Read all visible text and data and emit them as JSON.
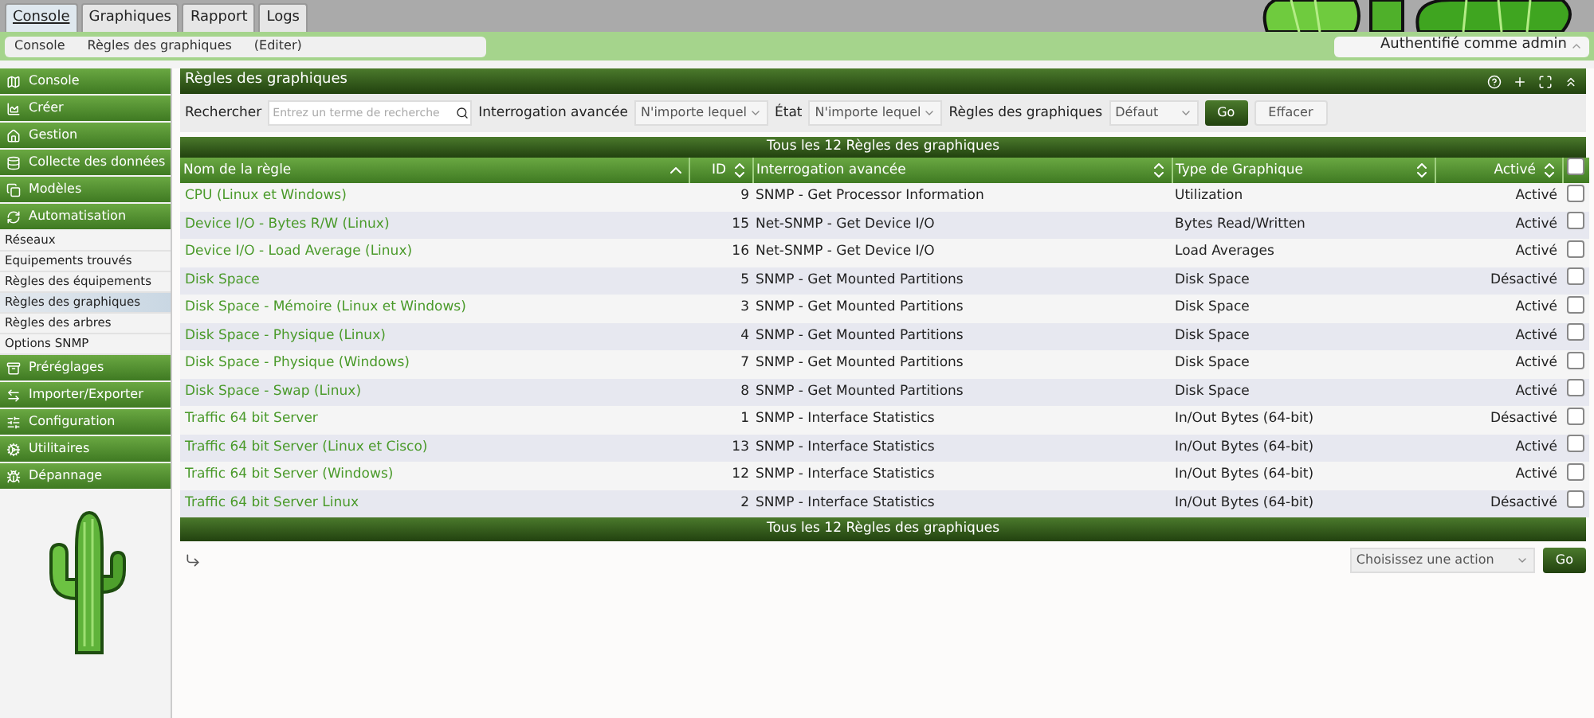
{
  "top_tabs": [
    {
      "label": "Console",
      "selected": true
    },
    {
      "label": "Graphiques",
      "selected": false
    },
    {
      "label": "Rapport",
      "selected": false
    },
    {
      "label": "Logs",
      "selected": false
    }
  ],
  "breadcrumb": [
    "Console",
    "Règles des graphiques",
    "(Editer)"
  ],
  "user": {
    "label": "Authentifié comme admin"
  },
  "sidebar": [
    {
      "kind": "section",
      "label": "Console"
    },
    {
      "kind": "section",
      "label": "Créer"
    },
    {
      "kind": "section",
      "label": "Gestion"
    },
    {
      "kind": "section",
      "label": "Collecte des données"
    },
    {
      "kind": "section",
      "label": "Modèles"
    },
    {
      "kind": "section",
      "label": "Automatisation"
    },
    {
      "kind": "link",
      "label": "Réseaux",
      "selected": false
    },
    {
      "kind": "link",
      "label": "Equipements trouvés",
      "selected": false
    },
    {
      "kind": "link",
      "label": "Règles des équipements",
      "selected": false
    },
    {
      "kind": "link",
      "label": "Règles des graphiques",
      "selected": true
    },
    {
      "kind": "link",
      "label": "Règles des arbres",
      "selected": false
    },
    {
      "kind": "link",
      "label": "Options SNMP",
      "selected": false
    },
    {
      "kind": "section",
      "label": "Préréglages"
    },
    {
      "kind": "section",
      "label": "Importer/Exporter"
    },
    {
      "kind": "section",
      "label": "Configuration"
    },
    {
      "kind": "section",
      "label": "Utilitaires"
    },
    {
      "kind": "section",
      "label": "Dépannage"
    }
  ],
  "panel": {
    "title": "Règles des graphiques",
    "filters": {
      "search_label": "Rechercher",
      "search_placeholder": "Entrez un terme de recherche",
      "query_label": "Interrogation avancée",
      "query_value": "N'importe lequel",
      "state_label": "État",
      "state_value": "N'importe lequel",
      "rules_label": "Règles des graphiques",
      "rules_value": "Défaut",
      "go": "Go",
      "clear": "Effacer"
    },
    "summary_top": "Tous les 12 Règles des graphiques",
    "columns": [
      {
        "label": "Nom de la règle",
        "sorted": true
      },
      {
        "label": "ID",
        "sorted": false
      },
      {
        "label": "Interrogation avancée",
        "sorted": false
      },
      {
        "label": "Type de Graphique",
        "sorted": false
      },
      {
        "label": "Activé",
        "sorted": false
      }
    ],
    "select_all": {
      "checked": false
    },
    "rows": [
      {
        "name": "CPU (Linux et Windows)",
        "id": "9",
        "query": "SNMP - Get Processor Information",
        "type": "Utilization",
        "status": "Activé",
        "checked": false
      },
      {
        "name": "Device I/O - Bytes R/W (Linux)",
        "id": "15",
        "query": "Net-SNMP - Get Device I/O",
        "type": "Bytes Read/Written",
        "status": "Activé",
        "checked": false
      },
      {
        "name": "Device I/O - Load Average (Linux)",
        "id": "16",
        "query": "Net-SNMP - Get Device I/O",
        "type": "Load Averages",
        "status": "Activé",
        "checked": false
      },
      {
        "name": "Disk Space",
        "id": "5",
        "query": "SNMP - Get Mounted Partitions",
        "type": "Disk Space",
        "status": "Désactivé",
        "checked": false
      },
      {
        "name": "Disk Space - Mémoire (Linux et Windows)",
        "id": "3",
        "query": "SNMP - Get Mounted Partitions",
        "type": "Disk Space",
        "status": "Activé",
        "checked": false
      },
      {
        "name": "Disk Space - Physique (Linux)",
        "id": "4",
        "query": "SNMP - Get Mounted Partitions",
        "type": "Disk Space",
        "status": "Activé",
        "checked": false
      },
      {
        "name": "Disk Space - Physique (Windows)",
        "id": "7",
        "query": "SNMP - Get Mounted Partitions",
        "type": "Disk Space",
        "status": "Activé",
        "checked": false
      },
      {
        "name": "Disk Space - Swap (Linux)",
        "id": "8",
        "query": "SNMP - Get Mounted Partitions",
        "type": "Disk Space",
        "status": "Activé",
        "checked": false
      },
      {
        "name": "Traffic 64 bit Server",
        "id": "1",
        "query": "SNMP - Interface Statistics",
        "type": "In/Out Bytes (64-bit)",
        "status": "Désactivé",
        "checked": false
      },
      {
        "name": "Traffic 64 bit Server (Linux et Cisco)",
        "id": "13",
        "query": "SNMP - Interface Statistics",
        "type": "In/Out Bytes (64-bit)",
        "status": "Activé",
        "checked": false
      },
      {
        "name": "Traffic 64 bit Server (Windows)",
        "id": "12",
        "query": "SNMP - Interface Statistics",
        "type": "In/Out Bytes (64-bit)",
        "status": "Activé",
        "checked": false
      },
      {
        "name": "Traffic 64 bit Server Linux",
        "id": "2",
        "query": "SNMP - Interface Statistics",
        "type": "In/Out Bytes (64-bit)",
        "status": "Désactivé",
        "checked": false
      }
    ],
    "summary_bottom": "Tous les 12 Règles des graphiques",
    "action": {
      "placeholder": "Choisissez une action",
      "go": "Go"
    }
  }
}
